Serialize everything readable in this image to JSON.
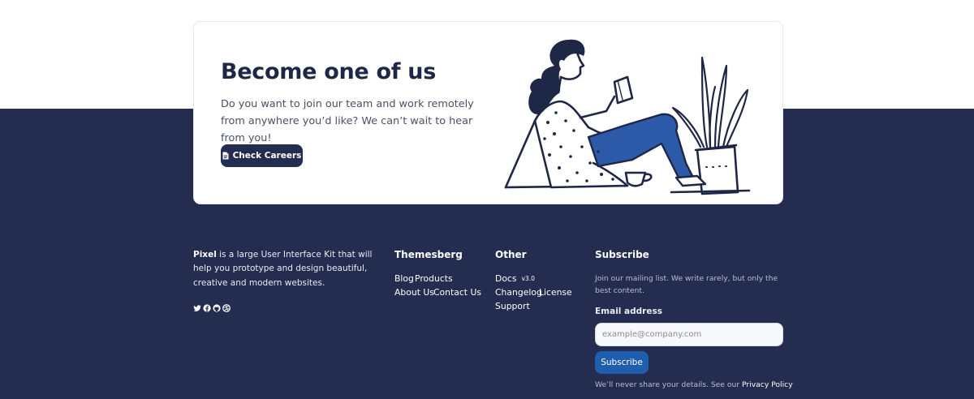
{
  "colors": {
    "dark_background": "#242c4f",
    "button_primary": "#242c4f",
    "button_subscribe": "#1f5eac",
    "pants_blue": "#2c5aa8"
  },
  "cta": {
    "title": "Become one of us",
    "text": "Do you want to join our team and work remotely from anywhere you’d like? We can’t wait to hear from you!",
    "button_label": "Check Careers",
    "button_icon": "document-icon",
    "illustration": "woman-reading-with-plant"
  },
  "footer": {
    "about": {
      "brand": "Pixel",
      "text": " is a large User Interface Kit that will help you prototype and design beautiful, creative and modern websites."
    },
    "social_icons": [
      "twitter-icon",
      "facebook-icon",
      "github-icon",
      "dribbble-icon"
    ],
    "themesberg": {
      "title": "Themesberg",
      "links": [
        "Blog",
        "Products",
        "About Us",
        "Contact Us"
      ]
    },
    "other": {
      "title": "Other",
      "docs": "Docs",
      "version": "v3.0",
      "links": [
        "Changelog",
        "License",
        "Support"
      ]
    },
    "subscribe": {
      "title": "Subscribe",
      "text": "Join our mailing list. We write rarely, but only the best content.",
      "email_label": "Email address",
      "email_placeholder": "example@company.com",
      "button_label": "Subscribe",
      "privacy_text": "We’ll never share your details. See our ",
      "privacy_link": "Privacy Policy"
    }
  }
}
